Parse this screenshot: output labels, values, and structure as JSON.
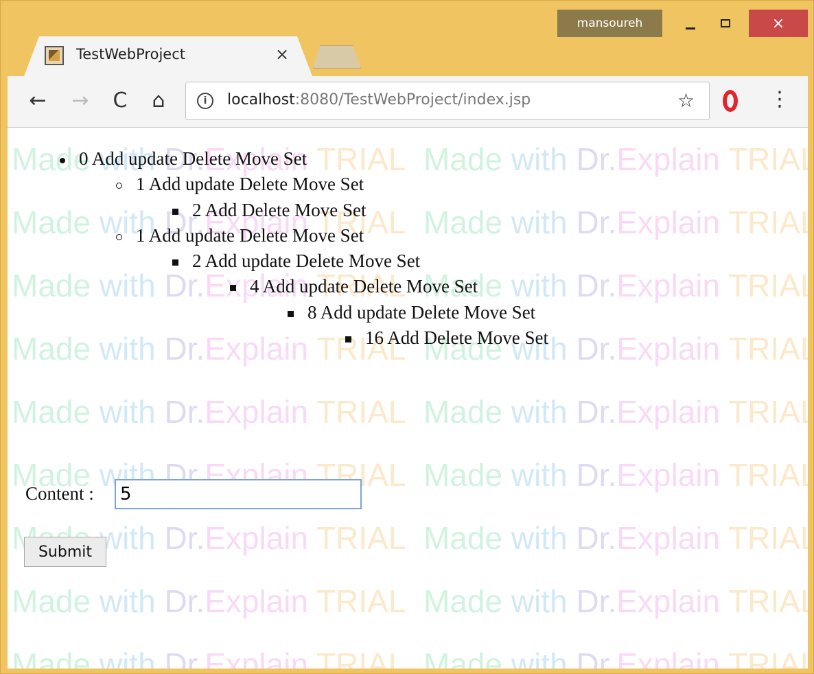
{
  "window": {
    "user": "mansoureh",
    "close_glyph": "×"
  },
  "tab": {
    "title": "TestWebProject",
    "close_glyph": "×"
  },
  "toolbar": {
    "back_glyph": "←",
    "forward_glyph": "→",
    "reload_glyph": "C",
    "home_glyph": "⌂",
    "info_glyph": "i",
    "url_host": "localhost",
    "url_rest": ":8080/TestWebProject/index.jsp",
    "star_glyph": "☆",
    "menu_glyph": "⋮"
  },
  "watermark": {
    "segments": [
      "Made ",
      "with ",
      "Dr.",
      "Explain ",
      "TRIAL"
    ]
  },
  "tree": {
    "nodes": [
      {
        "text": "0 Add update Delete Move Set"
      },
      {
        "text": "1 Add update Delete Move Set"
      },
      {
        "text": "2 Add  Delete Move Set"
      },
      {
        "text": "1 Add update Delete Move Set"
      },
      {
        "text": "2 Add update Delete Move Set"
      },
      {
        "text": "4 Add update Delete Move Set"
      },
      {
        "text": "8 Add update Delete Move Set"
      },
      {
        "text": "16 Add  Delete Move Set"
      }
    ]
  },
  "form": {
    "content_label": "Content :",
    "content_value": "5",
    "submit_label": "Submit"
  }
}
